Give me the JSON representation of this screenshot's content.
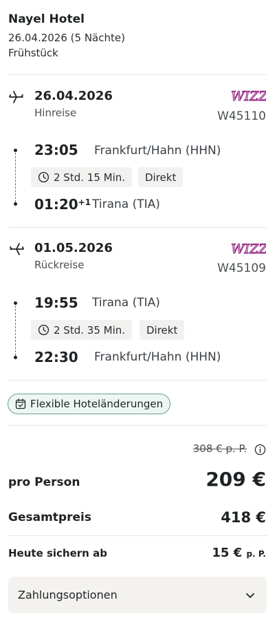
{
  "hotel": {
    "name": "Nayel Hotel",
    "dates": "26.04.2026 (5 Nächte)",
    "board": "Frühstück"
  },
  "outbound": {
    "date": "26.04.2026",
    "direction": "Hinreise",
    "airline_logo": "wizz-air-logo",
    "flight_number": "W45110",
    "departure_time": "23:05",
    "departure_airport": "Frankfurt/Hahn (HHN)",
    "duration": "2 Std. 15 Min.",
    "stops": "Direkt",
    "arrival_time": "01:20",
    "arrival_day_offset": "+1",
    "arrival_airport": "Tirana (TIA)",
    "icon": "plane-departure-icon"
  },
  "return": {
    "date": "01.05.2026",
    "direction": "Rückreise",
    "airline_logo": "wizz-air-logo",
    "flight_number": "W45109",
    "departure_time": "19:55",
    "departure_airport": "Tirana (TIA)",
    "duration": "2 Std. 35 Min.",
    "stops": "Direkt",
    "arrival_time": "22:30",
    "arrival_airport": "Frankfurt/Hahn (HHN)",
    "icon": "plane-arrival-icon"
  },
  "flex_badge": "Flexible Hoteländerungen",
  "pricing": {
    "old_price": "308 € p. P.",
    "per_person_label": "pro Person",
    "per_person_value": "209 €",
    "total_label": "Gesamtpreis",
    "total_value": "418 €",
    "deposit_label": "Heute sichern ab",
    "deposit_value": "15 €",
    "deposit_unit": "p. P."
  },
  "payment_options": "Zahlungsoptionen",
  "colors": {
    "wizz_brand": "#9b2f8a",
    "badge_border": "#6aa08a",
    "badge_bg": "#eef6f2"
  }
}
